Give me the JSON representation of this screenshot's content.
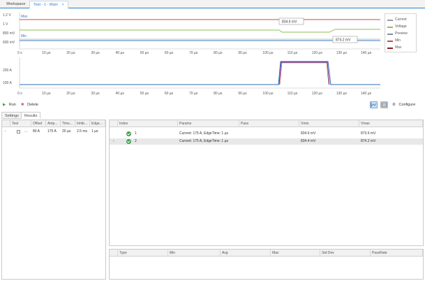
{
  "tabs": [
    {
      "label": "Workspace"
    },
    {
      "label": "Test - 1 - Main",
      "close": "×"
    }
  ],
  "top_chart": {
    "y_ticks": [
      "1.2 V",
      "1 V",
      "800 mV",
      "600 mV"
    ],
    "x_ticks": [
      "0 s",
      "10 µs",
      "20 µs",
      "30 µs",
      "40 µs",
      "50 µs",
      "60 µs",
      "70 µs",
      "80 µs",
      "90 µs",
      "100 µs",
      "110 µs",
      "120 µs",
      "130 µs",
      "140 µs"
    ],
    "max_label": "Max",
    "min_label": "Min",
    "callout_1": "834.6 mV",
    "callout_2": "874.2 mV"
  },
  "bottom_chart": {
    "y_ticks": [
      "200 A",
      "100 A"
    ],
    "x_ticks": [
      "0 s",
      "10 µs",
      "20 µs",
      "30 µs",
      "40 µs",
      "50 µs",
      "60 µs",
      "70 µs",
      "80 µs",
      "90 µs",
      "100 µs",
      "110 µs",
      "120 µs",
      "130 µs",
      "140 µs"
    ]
  },
  "legend": [
    {
      "label": "Current",
      "color": "#9a9a9a"
    },
    {
      "label": "Voltage",
      "color": "#8cc152"
    },
    {
      "label": "Preview",
      "color": "#7d8fa6"
    },
    {
      "label": "Min",
      "color": "#c0504d"
    },
    {
      "label": "Max",
      "color": "#8b1a1a"
    }
  ],
  "colors": {
    "voltage": "#8cc152",
    "preview": "#7d8fa6",
    "max_line": "#c0504d",
    "min_line": "#3f78b8",
    "current_base": "#2f6fb8",
    "current_pulse": "#6b2a8c",
    "accent": "#2f7fd0"
  },
  "toolbar": {
    "run": "Run",
    "delete": "Delete",
    "configure": "Configure"
  },
  "subtabs": [
    {
      "label": "Settings"
    },
    {
      "label": "Results"
    }
  ],
  "left_grid": {
    "headers": [
      "Test",
      "Offset",
      "Amp...",
      "Tims...",
      "Inhib...",
      "Edge..."
    ],
    "rows": [
      {
        "expander": "›",
        "dots": "...",
        "offset": "80 A",
        "amp": "175 A",
        "time": "20 µs",
        "inhib": "2.5 ms",
        "edge": "1 µs"
      }
    ]
  },
  "right_grid": {
    "headers": [
      "Index",
      "Params",
      "Pass",
      "Vmin",
      "Vmax"
    ],
    "rows": [
      {
        "index": "1",
        "params": "Current: 175 A, EdgeTime: 1 µs",
        "vmin": "834.6 mV",
        "vmax": "873.6 mV"
      },
      {
        "index": "2",
        "params": "Current: 175 A, EdgeTime: 1 µs",
        "vmin": "834.4 mV",
        "vmax": "874.2 mV"
      }
    ],
    "selected_marker": "›"
  },
  "stats_grid": {
    "headers": [
      "Type",
      "Min",
      "Avg",
      "Max",
      "Std Dev",
      "PassRate"
    ]
  }
}
